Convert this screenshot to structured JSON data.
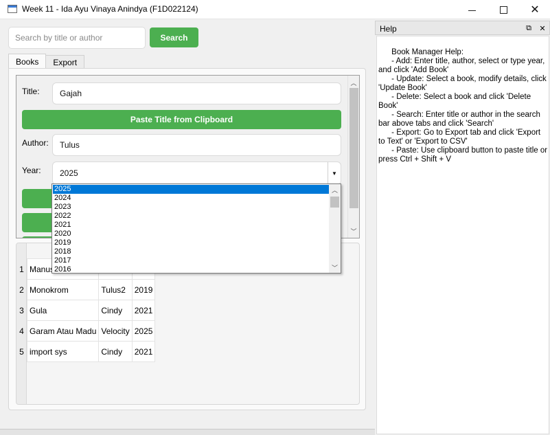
{
  "window": {
    "title": "Week 11 - Ida Ayu Vinaya Anindya (F1D022124)",
    "minimize_label": "—",
    "maximize_label": "☐",
    "close_label": "✕"
  },
  "search": {
    "placeholder": "Search by title or author",
    "value": "",
    "button_label": "Search"
  },
  "tabs": [
    {
      "label": "Books",
      "active": true
    },
    {
      "label": "Export",
      "active": false
    }
  ],
  "form": {
    "title_label": "Title:",
    "title_value": "Gajah",
    "paste_button_label": "Paste Title from Clipboard",
    "author_label": "Author:",
    "author_value": "Tulus",
    "year_label": "Year:",
    "year_value": "2025"
  },
  "year_dropdown": {
    "options": [
      "2025",
      "2024",
      "2023",
      "2022",
      "2021",
      "2020",
      "2019",
      "2018",
      "2017",
      "2016"
    ],
    "selected": "2025"
  },
  "table": {
    "rows": [
      {
        "num": "1",
        "title": "Manus",
        "author": "",
        "year": ""
      },
      {
        "num": "2",
        "title": "Monokrom",
        "author": "Tulus2",
        "year": "2019"
      },
      {
        "num": "3",
        "title": "Gula",
        "author": "Cindy",
        "year": "2021"
      },
      {
        "num": "4",
        "title": "Garam Atau Madu",
        "author": "Velocity",
        "year": "2025"
      },
      {
        "num": "5",
        "title": "import sys",
        "author": "Cindy",
        "year": "2021"
      }
    ]
  },
  "help": {
    "title": "Help",
    "float_label": "⧉",
    "close_label": "✕",
    "text": "      Book Manager Help:\n      - Add: Enter title, author, select or type year, and click 'Add Book'\n      - Update: Select a book, modify details, click 'Update Book'\n      - Delete: Select a book and click 'Delete Book'\n      - Search: Enter title or author in the search bar above tabs and click 'Search'\n      - Export: Go to Export tab and click 'Export to Text' or 'Export to CSV'\n      - Paste: Use clipboard button to paste title or press Ctrl + Shift + V"
  },
  "colors": {
    "accent_green": "#4caf50",
    "selection_blue": "#0078d7"
  }
}
